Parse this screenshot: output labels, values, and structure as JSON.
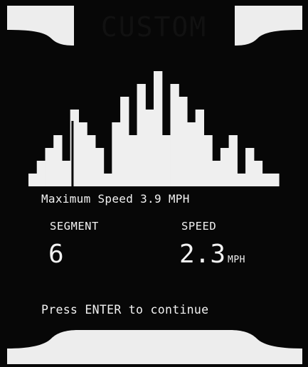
{
  "screen": {
    "title": "CUSTOM",
    "max_speed_prefix": "Maximum Speed",
    "max_speed_value": "3.9",
    "max_speed_unit": "MPH",
    "segment_label": "SEGMENT",
    "segment_value": "6",
    "speed_label": "SPEED",
    "speed_value": "2.3",
    "speed_unit": "MPH",
    "prompt": "Press ENTER to continue"
  },
  "profile": {
    "segment_levels": [
      1,
      2,
      3,
      4,
      2,
      6,
      5,
      4,
      3,
      1,
      5,
      7,
      4,
      8,
      6,
      9,
      4,
      8,
      7,
      5,
      6,
      4,
      2,
      3,
      4,
      1,
      3,
      2,
      1,
      1
    ],
    "selected_segment": 6,
    "bar_color": "#efefef",
    "background_color": "#070707"
  }
}
